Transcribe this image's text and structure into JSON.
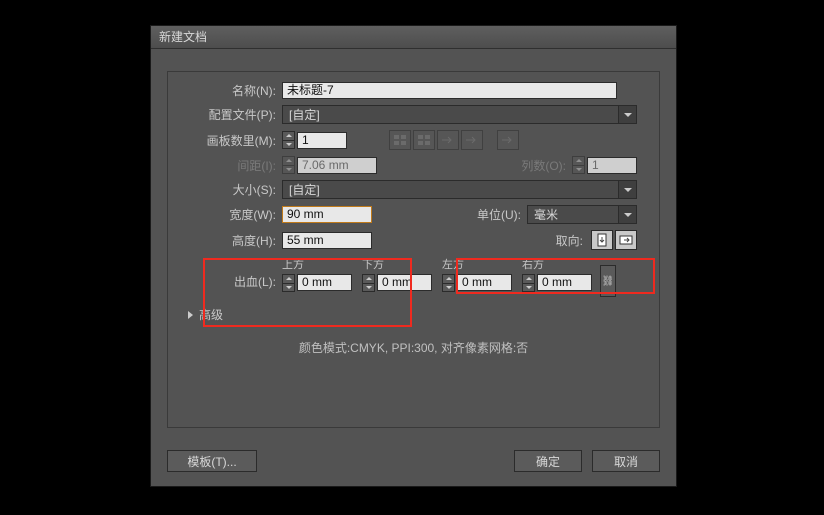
{
  "dialog": {
    "title": "新建文档",
    "name_label": "名称(N):",
    "name_value": "未标题-7",
    "profile_label": "配置文件(P):",
    "profile_value": "[自定]",
    "artboards_label": "画板数里(M):",
    "artboards_value": "1",
    "spacing_label": "间距(I):",
    "spacing_value": "7.06 mm",
    "cols_label": "列数(O):",
    "cols_value": "1",
    "size_label": "大小(S):",
    "size_value": "[自定]",
    "width_label": "宽度(W):",
    "width_value": "90 mm",
    "height_label": "高度(H):",
    "height_value": "55 mm",
    "unit_label": "单位(U):",
    "unit_value": "毫米",
    "orient_label": "取向:",
    "bleed_label": "出血(L):",
    "bleed_top": "上方",
    "bleed_bottom": "下方",
    "bleed_left": "左方",
    "bleed_right": "右方",
    "bleed_val": "0 mm",
    "advanced": "高级",
    "summary": "颜色模式:CMYK, PPI:300, 对齐像素网格:否",
    "template_btn": "模板(T)...",
    "ok": "确定",
    "cancel": "取消"
  }
}
